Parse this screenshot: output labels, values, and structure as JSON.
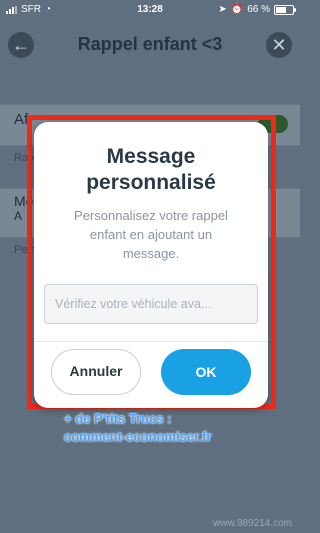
{
  "status_bar": {
    "carrier": "SFR",
    "time": "13:28",
    "battery": "66 %",
    "battery_level": 0.66
  },
  "nav": {
    "title": "Rappel enfant <3"
  },
  "background": {
    "row1": "Af",
    "desc1": "Ra ve",
    "row2_title": "Me",
    "row2_sub": "A",
    "desc2": "Pe ro"
  },
  "dialog": {
    "title": "Message personnalisé",
    "text": "Personnalisez votre rappel enfant en ajoutant un message.",
    "input_placeholder": "Vérifiez votre véhicule ava...",
    "input_value": "",
    "cancel_label": "Annuler",
    "ok_label": "OK"
  },
  "watermark": {
    "line1": "+ de P'tits Trucs :",
    "line2": "comment-economiser.fr"
  },
  "credit": "www.989214.com",
  "colors": {
    "ok_button": "#1aa1e3",
    "highlight": "#f02a1a"
  }
}
